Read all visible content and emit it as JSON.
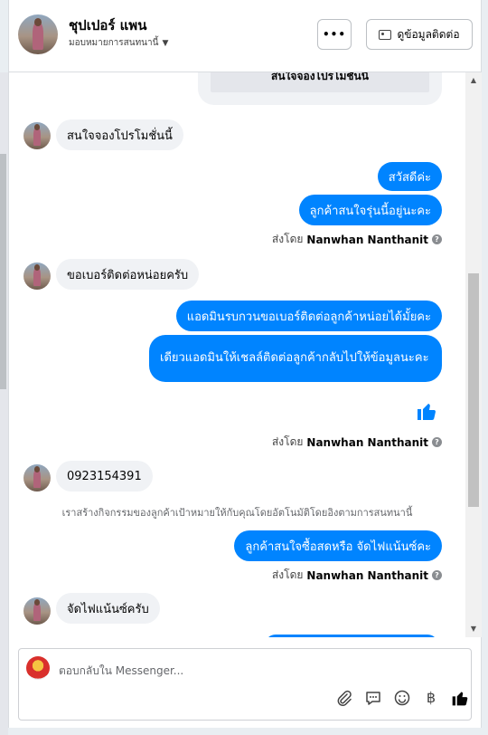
{
  "header": {
    "name": "ชุปเปอร์ แพน",
    "assign_label": "มอบหมายการสนทนานี้",
    "more_label": "•••",
    "contact_label": "ดูข้อมูลติดต่อ"
  },
  "chat": {
    "card_button": "สนใจจองโปรโมชั่นนี้",
    "messages": [
      {
        "text": "สนใจจองโปรโมชั่นนี้"
      },
      {
        "text": "สวัสดีค่ะ"
      },
      {
        "text": "ลูกค้าสนใจรุ่นนี้อยู่นะคะ"
      },
      {
        "text": "ขอเบอร์ติดต่อหน่อยครับ"
      },
      {
        "text": "แอดมินรบกวนขอเบอร์ติดต่อลูกค้าหน่อยได้มั้ยคะ"
      },
      {
        "text": "เดียวแอดมินให้เชลล์ติดต่อลูกค้ากลับไปให้ข้อมูลนะคะ"
      },
      {
        "text": "0923154391"
      },
      {
        "text": "ลูกค้าสนใจซื้อสดหรือ จัดไฟแน้นซ์คะ"
      },
      {
        "text": "จัดไฟแน้นซ์ครับ"
      }
    ],
    "sent_by_prefix": "ส่งโดย",
    "sent_by_name": "Nanwhan Nanthanit",
    "activity_note": "เราสร้างกิจกรรมของลูกค้าเป้าหมายให้กับคุณโดยอัตโนมัติโดยอิงตามการสนทนานี้"
  },
  "composer": {
    "placeholder": "ตอบกลับใน Messenger..."
  },
  "colors": {
    "accent": "#0084ff",
    "bubble_in": "#f0f2f5"
  },
  "icons": [
    "attach-icon",
    "quick-reply-icon",
    "emoji-icon",
    "currency-icon",
    "like-icon",
    "help-icon",
    "contact-card-icon",
    "caret-down-icon"
  ]
}
